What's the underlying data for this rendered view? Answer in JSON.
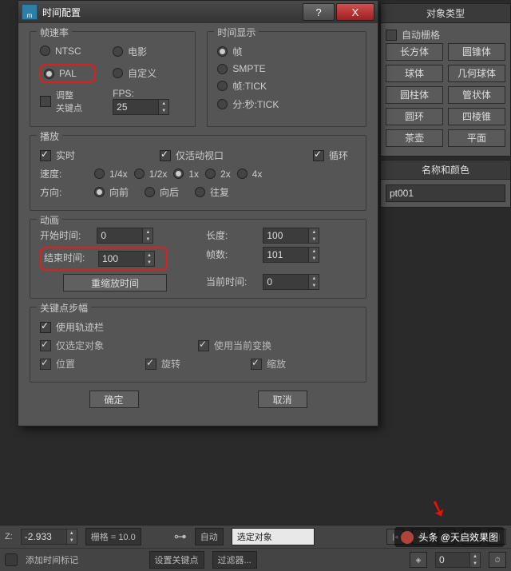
{
  "dialog": {
    "title": "时间配置",
    "help": "?",
    "close": "X",
    "ok": "确定",
    "cancel": "取消"
  },
  "frameRate": {
    "legend": "帧速率",
    "ntsc": "NTSC",
    "film": "电影",
    "pal": "PAL",
    "custom": "自定义",
    "adjustKeys": "调整\n关键点",
    "fpsLabel": "FPS:",
    "fps": "25"
  },
  "timeDisplay": {
    "legend": "时间显示",
    "frames": "帧",
    "smpte": "SMPTE",
    "frameTick": "帧:TICK",
    "mmss": "分:秒:TICK"
  },
  "playback": {
    "legend": "播放",
    "realtime": "实时",
    "activeOnly": "仅活动视口",
    "loop": "循环",
    "speedLabel": "速度:",
    "speeds": [
      "1/4x",
      "1/2x",
      "1x",
      "2x",
      "4x"
    ],
    "dirLabel": "方向:",
    "dirs": [
      "向前",
      "向后",
      "往复"
    ]
  },
  "anim": {
    "legend": "动画",
    "startLabel": "开始时间:",
    "start": "0",
    "endLabel": "结束时间:",
    "end": "100",
    "lenLabel": "长度:",
    "len": "100",
    "countLabel": "帧数:",
    "count": "101",
    "rescale": "重缩放时间",
    "curLabel": "当前时间:",
    "cur": "0"
  },
  "keyStep": {
    "legend": "关键点步幅",
    "useTrackBar": "使用轨迹栏",
    "selOnly": "仅选定对象",
    "useCurXform": "使用当前变换",
    "pos": "位置",
    "rot": "旋转",
    "scl": "缩放"
  },
  "side": {
    "typeHead": "对象类型",
    "autoGrid": "自动栅格",
    "rows": [
      [
        "长方体",
        "圆锥体"
      ],
      [
        "球体",
        "几何球体"
      ],
      [
        "圆柱体",
        "管状体"
      ],
      [
        "圆环",
        "四棱锥"
      ],
      [
        "茶壶",
        "平面"
      ]
    ],
    "nameHead": "名称和颜色",
    "name": "pt001"
  },
  "bottom": {
    "zLabel": "Z:",
    "z": "-2.933",
    "grid": "栅格 = 10.0",
    "addTag": "添加时间标记",
    "auto": "自动",
    "selObj": "选定对象",
    "setKey": "设置关键点",
    "filters": "过滤器...",
    "frame": "0"
  },
  "credit": "头条 @天启效果图"
}
